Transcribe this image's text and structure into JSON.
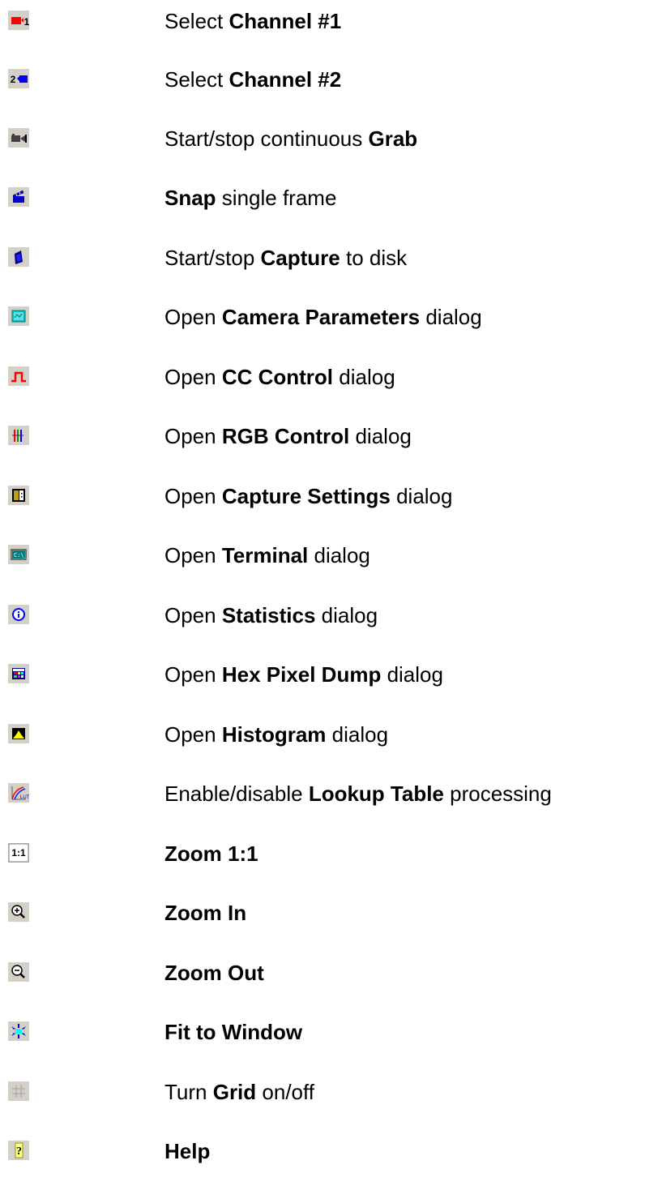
{
  "toolbar_buttons": [
    {
      "icon": "channel-1-icon",
      "pre": "Select ",
      "bold": "Channel #1",
      "post": ""
    },
    {
      "icon": "channel-2-icon",
      "pre": "Select ",
      "bold": "Channel #2",
      "post": ""
    },
    {
      "icon": "video-camera-icon",
      "pre": "Start/stop continuous ",
      "bold": "Grab",
      "post": ""
    },
    {
      "icon": "clapper-icon",
      "pre": "",
      "bold": "Snap",
      "post": " single frame"
    },
    {
      "icon": "disk-capture-icon",
      "pre": "Start/stop ",
      "bold": "Capture",
      "post": " to disk"
    },
    {
      "icon": "camera-parameters-icon",
      "pre": "Open ",
      "bold": "Camera Parameters",
      "post": " dialog"
    },
    {
      "icon": "pulse-waveform-icon",
      "pre": "Open ",
      "bold": "CC Control",
      "post": " dialog"
    },
    {
      "icon": "rgb-bars-icon",
      "pre": "Open ",
      "bold": "RGB Control",
      "post": " dialog"
    },
    {
      "icon": "capture-settings-icon",
      "pre": "Open ",
      "bold": "Capture Settings",
      "post": " dialog"
    },
    {
      "icon": "terminal-icon",
      "pre": "Open ",
      "bold": "Terminal",
      "post": " dialog"
    },
    {
      "icon": "info-icon",
      "pre": "Open ",
      "bold": "Statistics",
      "post": " dialog"
    },
    {
      "icon": "pixel-grid-icon",
      "pre": "Open ",
      "bold": "Hex Pixel Dump",
      "post": " dialog"
    },
    {
      "icon": "histogram-icon",
      "pre": "Open ",
      "bold": "Histogram",
      "post": " dialog"
    },
    {
      "icon": "lut-curve-icon",
      "pre": "Enable/disable ",
      "bold": "Lookup Table",
      "post": " processing"
    },
    {
      "icon": "zoom-1-1-icon",
      "pre": "",
      "bold": "Zoom 1:1",
      "post": ""
    },
    {
      "icon": "zoom-in-icon",
      "pre": "",
      "bold": "Zoom In",
      "post": ""
    },
    {
      "icon": "zoom-out-icon",
      "pre": "",
      "bold": "Zoom Out",
      "post": ""
    },
    {
      "icon": "fit-to-window-icon",
      "pre": "",
      "bold": "Fit to Window",
      "post": ""
    },
    {
      "icon": "grid-icon",
      "pre": "Turn ",
      "bold": "Grid",
      "post": " on/off"
    },
    {
      "icon": "help-icon",
      "pre": "",
      "bold": "Help",
      "post": ""
    }
  ],
  "icon_labels": {
    "channel_1": "1",
    "channel_2": "2",
    "zoom_1_1": "1:1",
    "help": "?"
  },
  "colors": {
    "button_face": "#d4d0c8",
    "channel_1": "#ff0000",
    "channel_2": "#0000ff",
    "cyan": "#00ffff",
    "navy": "#000080"
  }
}
